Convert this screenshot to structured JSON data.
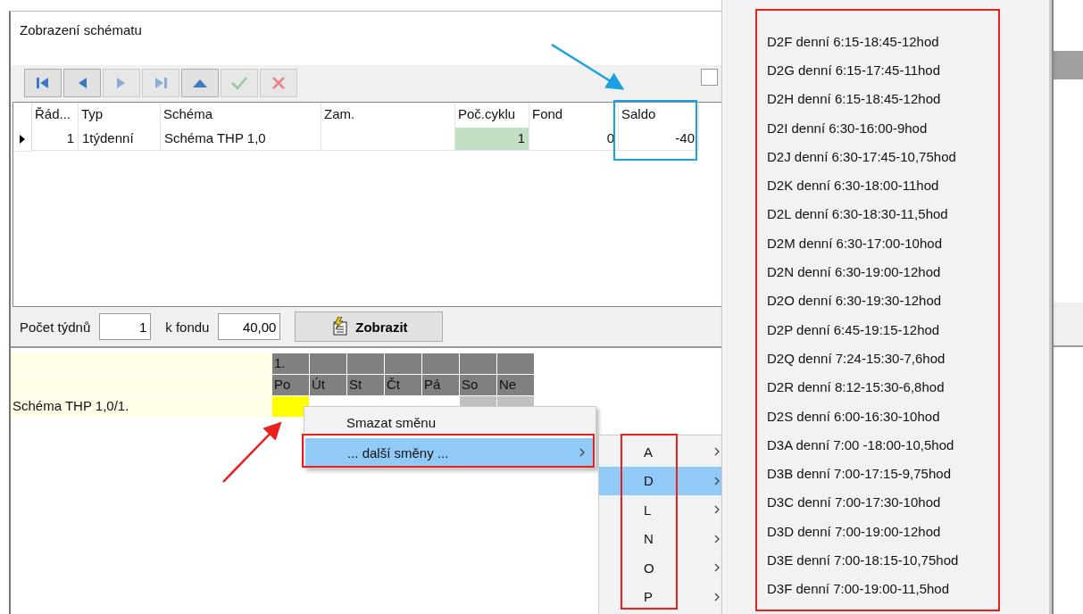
{
  "window": {
    "title": "Zobrazení schématu"
  },
  "toolbar": [
    {
      "kind": "first",
      "disabled": false
    },
    {
      "kind": "prev",
      "disabled": false
    },
    {
      "kind": "next",
      "disabled": true
    },
    {
      "kind": "last",
      "disabled": true
    },
    {
      "kind": "up",
      "disabled": false
    },
    {
      "kind": "confirm",
      "disabled": true
    },
    {
      "kind": "cancel",
      "disabled": true
    }
  ],
  "toolbar_checkbox": {
    "checked": false
  },
  "table": {
    "columns": [
      "Řád...",
      "Typ",
      "Schéma",
      "Zam.",
      "Poč.cyklu",
      "Fond",
      "Saldo"
    ],
    "rows": [
      {
        "current": true,
        "cells": [
          "1",
          "1týdenní",
          "Schéma THP 1,0",
          "",
          "1",
          "0",
          "-40"
        ]
      }
    ]
  },
  "controls": {
    "weeks_label": "Počet týdnů",
    "weeks_value": "1",
    "fund_label": "k fondu",
    "fund_value": "40,00",
    "show_button": "Zobrazit"
  },
  "schedule": {
    "week": "1.",
    "days": [
      {
        "label": "Po",
        "weekend": false,
        "selected": true
      },
      {
        "label": "Út",
        "weekend": false,
        "selected": false
      },
      {
        "label": "St",
        "weekend": false,
        "selected": false
      },
      {
        "label": "Čt",
        "weekend": false,
        "selected": false
      },
      {
        "label": "Pá",
        "weekend": false,
        "selected": false
      },
      {
        "label": "So",
        "weekend": true,
        "selected": false
      },
      {
        "label": "Ne",
        "weekend": true,
        "selected": false
      }
    ],
    "row": {
      "label": "Schéma THP 1,0/1."
    }
  },
  "context_menu": [
    {
      "label": "Smazat směnu",
      "selected": false,
      "submenu": false
    },
    {
      "label": "... další směny ...",
      "selected": true,
      "submenu": true
    }
  ],
  "shift_groups": [
    {
      "label": "A",
      "selected": false
    },
    {
      "label": "D",
      "selected": true
    },
    {
      "label": "L",
      "selected": false
    },
    {
      "label": "N",
      "selected": false
    },
    {
      "label": "O",
      "selected": false
    },
    {
      "label": "P",
      "selected": false
    }
  ],
  "shifts": [
    "D2F denní 6:15-18:45-12hod",
    "D2G denní 6:15-17:45-11hod",
    "D2H denní 6:15-18:45-12hod",
    "D2I denní 6:30-16:00-9hod",
    "D2J denní 6:30-17:45-10,75hod",
    "D2K denní 6:30-18:00-11hod",
    "D2L denní 6:30-18:30-11,5hod",
    "D2M denní 6:30-17:00-10hod",
    "D2N denní 6:30-19:00-12hod",
    "D2O denní 6:30-19:30-12hod",
    "D2P denní 6:45-19:15-12hod",
    "D2Q denní 7:24-15:30-7,6hod",
    "D2R denní 8:12-15:30-6,8hod",
    "D2S denní 6:00-16:30-10hod",
    "D3A denní 7:00 -18:00-10,5hod",
    "D3B denní 7:00-17:15-9,75hod",
    "D3C denní 7:00-17:30-10hod",
    "D3D denní 7:00-19:00-12hod",
    "D3E denní 7:00-18:15-10,75hod",
    "D3F denní 7:00-19:00-11,5hod"
  ]
}
